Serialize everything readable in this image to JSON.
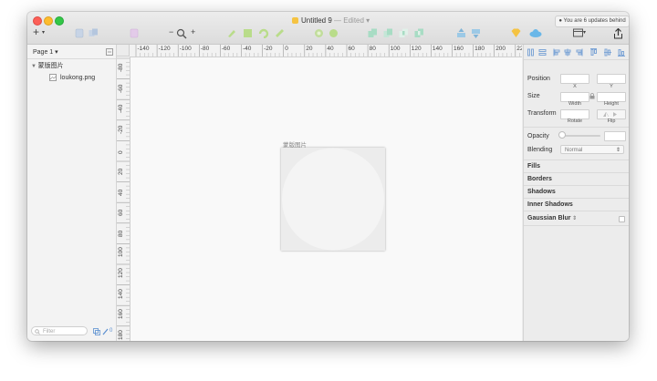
{
  "window": {
    "title": "Untitled 9",
    "title_separator": " — ",
    "edited": "Edited",
    "update_notice": "You are 6 updates behind"
  },
  "toolbar": {
    "insert_label": "+",
    "zoom_minus": "−",
    "zoom_plus": "+"
  },
  "left_panel": {
    "page_selector": "Page 1",
    "layers": [
      {
        "name": "蒙版图片",
        "type": "artboard"
      },
      {
        "name": "loukong.png",
        "type": "image"
      }
    ],
    "filter_placeholder": "Filter",
    "slice_count": "0"
  },
  "canvas": {
    "artboard_label": "蒙版图片",
    "h_ruler_labels": [
      "-140",
      "-120",
      "-100",
      "-80",
      "-60",
      "-40",
      "-20",
      "0",
      "20",
      "40",
      "60",
      "80",
      "100",
      "120",
      "140",
      "160",
      "180",
      "200",
      "220"
    ],
    "v_ruler_labels": [
      "-80",
      "-60",
      "-40",
      "-20",
      "0",
      "20",
      "40",
      "60",
      "80",
      "100",
      "120",
      "140",
      "160",
      "180"
    ]
  },
  "inspector": {
    "position_label": "Position",
    "x_label": "X",
    "y_label": "Y",
    "size_label": "Size",
    "width_label": "Width",
    "height_label": "Height",
    "transform_label": "Transform",
    "rotate_label": "Rotate",
    "flip_label": "Flip",
    "opacity_label": "Opacity",
    "blending_label": "Blending",
    "blending_value": "Normal",
    "sections": [
      "Fills",
      "Borders",
      "Shadows",
      "Inner Shadows",
      "Gaussian Blur"
    ]
  },
  "colors": {
    "accent_green": "#b9dc8a",
    "accent_gold": "#f5c342",
    "accent_blue": "#6ab7e8"
  }
}
